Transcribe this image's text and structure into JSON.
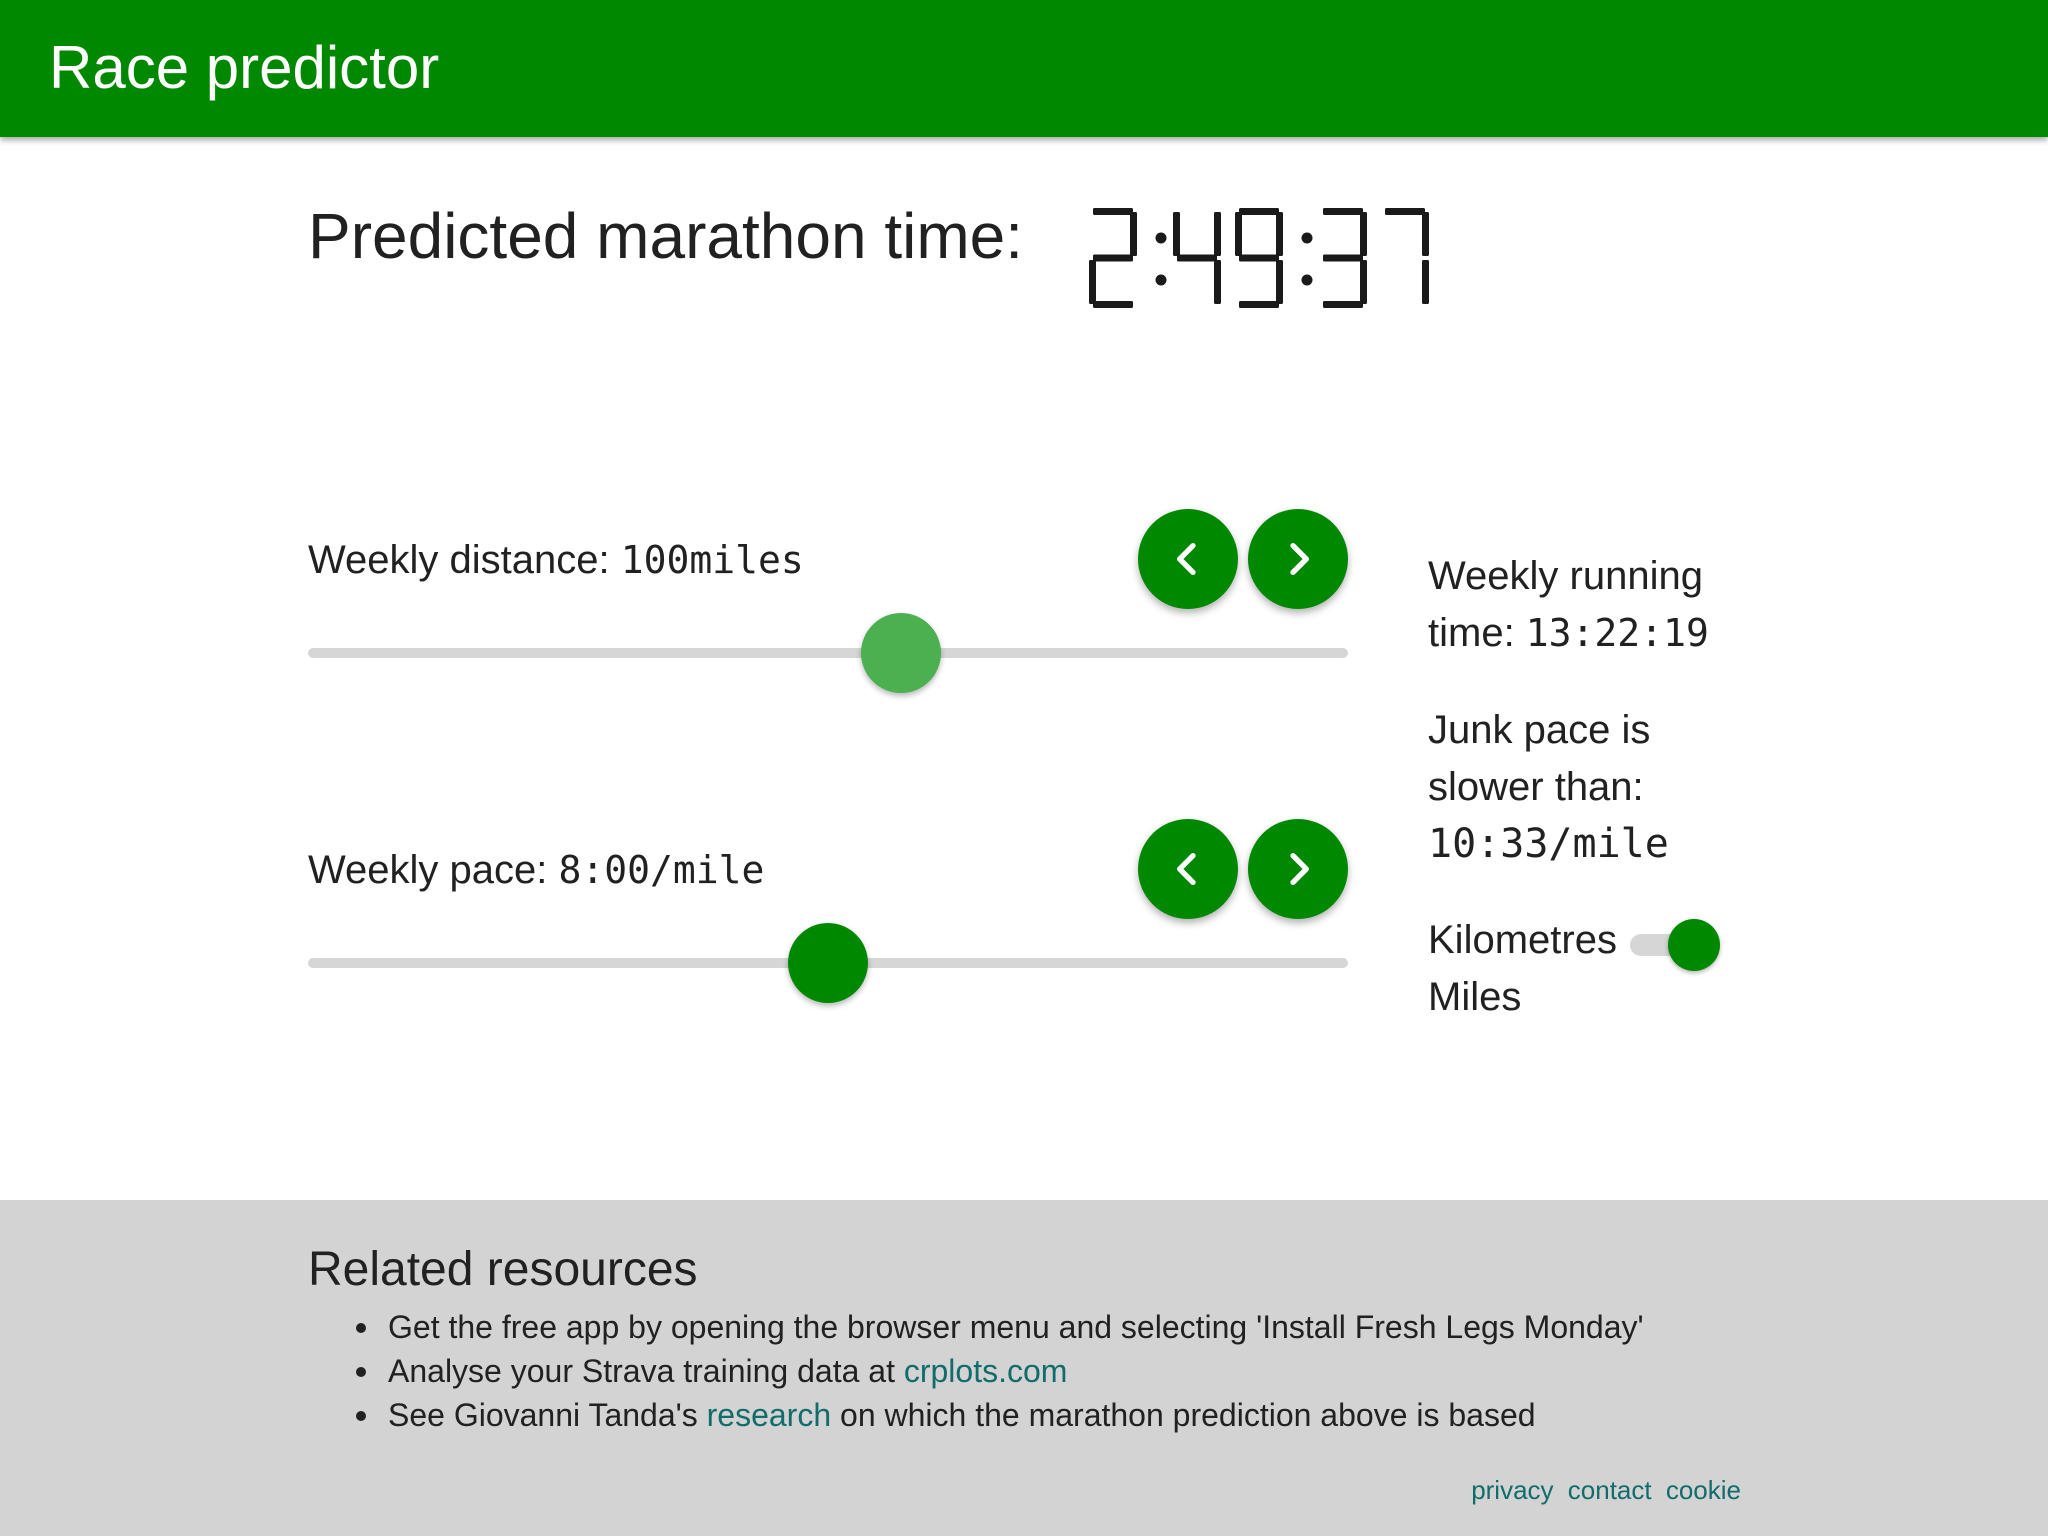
{
  "appbar": {
    "title": "Race predictor"
  },
  "prediction": {
    "label": "Predicted marathon time:",
    "time": "2:49:37"
  },
  "distance": {
    "label": "Weekly distance: ",
    "value": "100miles",
    "slider_fraction": 0.57,
    "thumb_color": "#4caf50"
  },
  "pace": {
    "label": "Weekly pace: ",
    "value": "8:00/mile",
    "slider_fraction": 0.5,
    "thumb_color": "#008800"
  },
  "buttons": {
    "prev_icon": "chevron-left-icon",
    "next_icon": "chevron-right-icon"
  },
  "sidebar": {
    "running_time_label_1": "Weekly running",
    "running_time_label_2": "time: ",
    "running_time_value": "13:22:19",
    "junk_label_1": "Junk pace is",
    "junk_label_2": "slower than:",
    "junk_value": "10:33/mile",
    "unit_km": "Kilometres",
    "unit_miles": "Miles",
    "unit_toggle_on": true
  },
  "resources": {
    "heading": "Related resources",
    "item1": "Get the free app by opening the browser menu and selecting 'Install Fresh Legs Monday'",
    "item2_text": "Analyse your Strava training data at ",
    "item2_link": "crplots.com",
    "item3_pre": "See Giovanni Tanda's ",
    "item3_link": "research",
    "item3_post": " on which the marathon prediction above is based"
  },
  "footer_links": {
    "privacy": "privacy",
    "contact": "contact",
    "cookie": "cookie"
  },
  "colors": {
    "brand": "#008800",
    "link": "#126c6c",
    "footer_bg": "#d3d3d3"
  }
}
